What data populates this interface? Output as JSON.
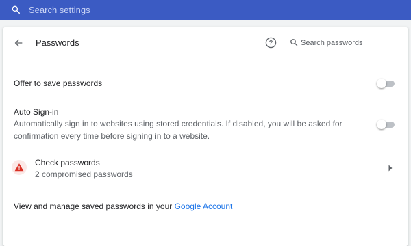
{
  "search_bar": {
    "placeholder": "Search settings",
    "icon": "search-icon"
  },
  "page": {
    "title": "Passwords",
    "help_icon": "help-icon",
    "search_placeholder": "Search passwords"
  },
  "offer_to_save": {
    "label": "Offer to save passwords",
    "enabled": false
  },
  "auto_signin": {
    "label": "Auto Sign-in",
    "description": "Automatically sign in to websites using stored credentials. If disabled, you will be asked for confirmation every time before signing in to a website.",
    "enabled": false
  },
  "check_passwords": {
    "label": "Check passwords",
    "status": "2 compromised passwords",
    "icon": "warning-icon"
  },
  "footer": {
    "prefix": "View and manage saved passwords in your ",
    "link_text": "Google Account"
  },
  "colors": {
    "header": "#3b5bc3",
    "link": "#1a73e8",
    "warning": "#d93025",
    "toggle_track": "#bdc1c6"
  }
}
